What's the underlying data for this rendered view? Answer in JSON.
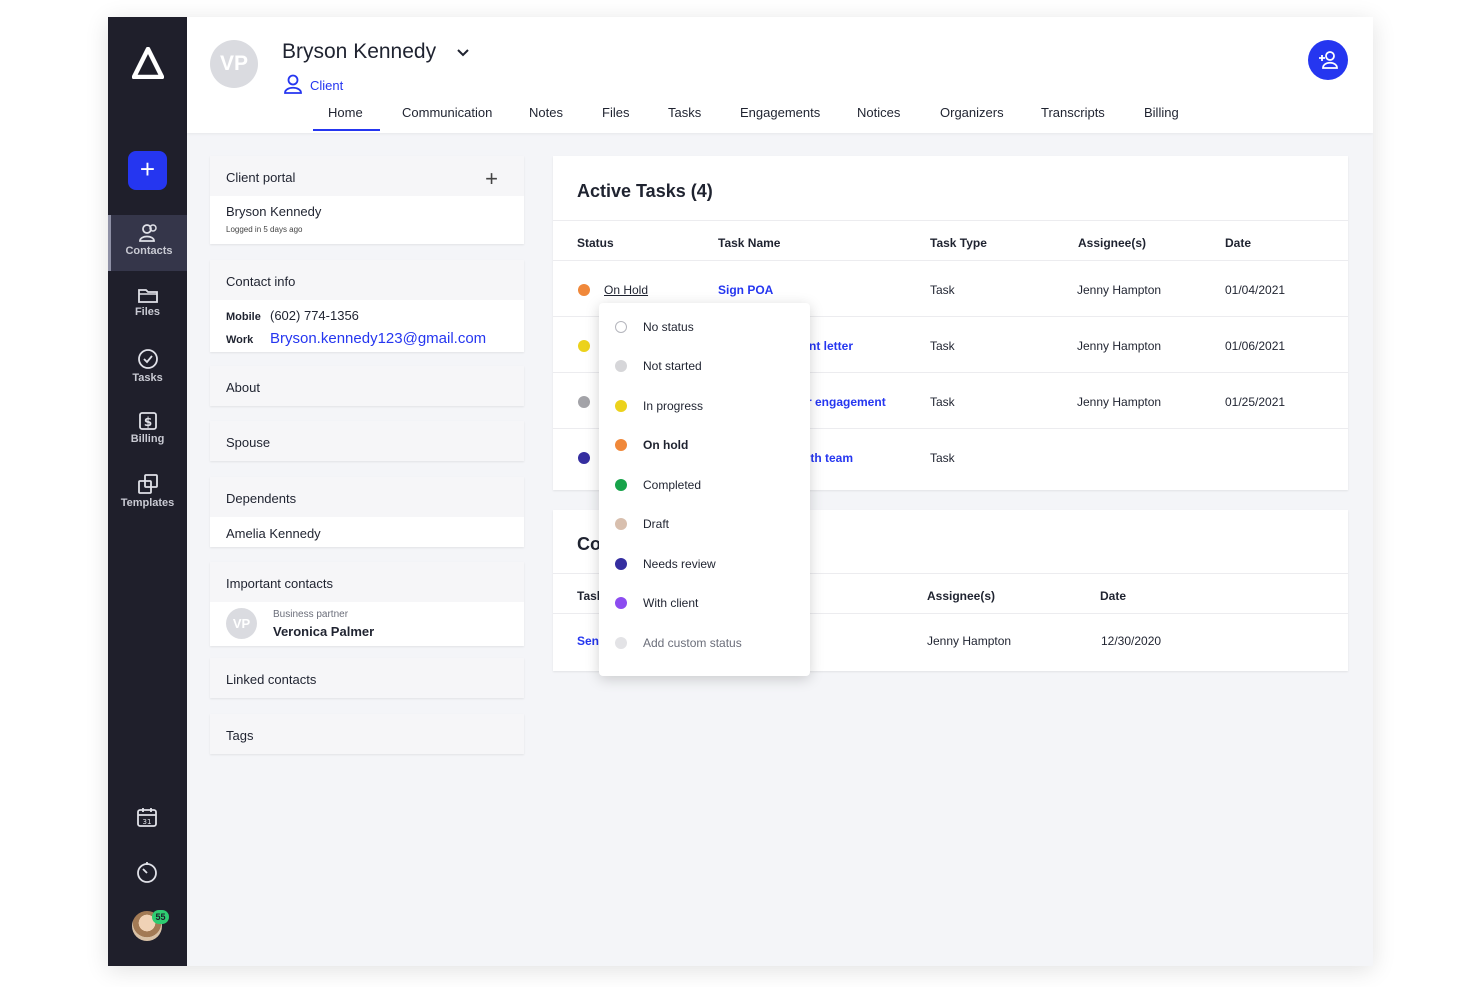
{
  "client": {
    "initials": "VP",
    "name": "Bryson Kennedy",
    "role": "Client"
  },
  "tabs": [
    "Home",
    "Communication",
    "Notes",
    "Files",
    "Tasks",
    "Engagements",
    "Notices",
    "Organizers",
    "Transcripts",
    "Billing"
  ],
  "active_tab": "Home",
  "sidebar": {
    "items": [
      {
        "label": "Contacts",
        "icon": "contacts-icon",
        "active": true
      },
      {
        "label": "Files",
        "icon": "folder-icon",
        "active": false
      },
      {
        "label": "Tasks",
        "icon": "check-circle-icon",
        "active": false
      },
      {
        "label": "Billing",
        "icon": "dollar-icon",
        "active": false
      },
      {
        "label": "Templates",
        "icon": "templates-icon",
        "active": false
      }
    ],
    "notification_count": "55"
  },
  "cards": {
    "client_portal": {
      "title": "Client portal",
      "name": "Bryson Kennedy",
      "last_login": "Logged in 5 days ago"
    },
    "contact_info": {
      "title": "Contact info",
      "mobile_label": "Mobile",
      "mobile": "(602) 774-1356",
      "work_label": "Work",
      "work": "Bryson.kennedy123@gmail.com"
    },
    "about": {
      "title": "About"
    },
    "spouse": {
      "title": "Spouse"
    },
    "dependents": {
      "title": "Dependents",
      "name": "Amelia Kennedy"
    },
    "important_contacts": {
      "title": "Important contacts",
      "initials": "VP",
      "relation": "Business partner",
      "name": "Veronica Palmer"
    },
    "linked_contacts": {
      "title": "Linked contacts"
    },
    "tags": {
      "title": "Tags"
    }
  },
  "active_tasks": {
    "title": "Active Tasks (4)",
    "headers": [
      "Status",
      "Task Name",
      "Task Type",
      "Assignee(s)",
      "Date"
    ],
    "rows": [
      {
        "status": "On Hold",
        "status_color": "#f0883a",
        "task": "Sign POA",
        "type": "Task",
        "assignee": "Jenny Hampton",
        "date": "01/04/2021"
      },
      {
        "status": "",
        "status_color": "#ecd21c",
        "task": "nt letter",
        "type": "Task",
        "assignee": "Jenny Hampton",
        "date": "01/06/2021"
      },
      {
        "status": "",
        "status_color": "#a3a3a8",
        "task": "r engagement",
        "type": "Task",
        "assignee": "Jenny Hampton",
        "date": "01/25/2021"
      },
      {
        "status": "",
        "status_color": "#352ea0",
        "task": "ith team",
        "type": "Task",
        "assignee": "",
        "date": ""
      }
    ]
  },
  "completed_tasks": {
    "title": "Co",
    "headers": [
      "Tasl",
      "Assignee(s)",
      "Date"
    ],
    "rows": [
      {
        "task": "Sen",
        "assignee": "Jenny Hampton",
        "date": "12/30/2020"
      }
    ]
  },
  "status_menu": {
    "options": [
      {
        "label": "No status",
        "color": "#ffffff",
        "outline": true
      },
      {
        "label": "Not started",
        "color": "#d6d6d9"
      },
      {
        "label": "In progress",
        "color": "#ecd21c"
      },
      {
        "label": "On hold",
        "color": "#f0883a",
        "selected": true
      },
      {
        "label": "Completed",
        "color": "#17a34a"
      },
      {
        "label": "Draft",
        "color": "#d8bfae"
      },
      {
        "label": "Needs review",
        "color": "#352ea0"
      },
      {
        "label": "With client",
        "color": "#8c4cf0"
      },
      {
        "label": "Add custom status",
        "color": "#e3e3e6",
        "muted": true
      }
    ]
  },
  "colors": {
    "accent": "#2536f0",
    "sidebar": "#1f1f2b"
  }
}
